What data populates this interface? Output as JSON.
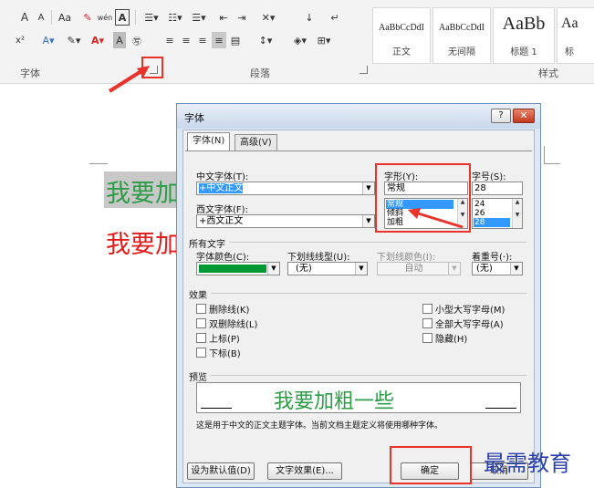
{
  "ribbon": {
    "font_buttons": [
      "A",
      "A",
      "Aa",
      "wén"
    ],
    "font_group_label": "字体",
    "paragraph_group_label": "段落",
    "styles_group_label": "样式",
    "styles": [
      {
        "sample": "AaBbCcDdI",
        "name": "正文"
      },
      {
        "sample": "AaBbCcDdI",
        "name": "无间隔"
      },
      {
        "sample": "AaBb",
        "name": "标题 1"
      },
      {
        "sample": "Aa",
        "name": "标"
      }
    ]
  },
  "document": {
    "line1": "我要加",
    "line2": "我要加",
    "line1_color": "#2e9b47",
    "line2_color": "#e31b1b",
    "highlight": "#c8c8c8"
  },
  "dialog": {
    "title": "字体",
    "tabs": [
      "字体(N)",
      "高级(V)"
    ],
    "chinese_font_label": "中文字体(T):",
    "chinese_font_value": "+中文正文",
    "western_font_label": "西文字体(F):",
    "western_font_value": "+西文正文",
    "style_label": "字形(Y):",
    "style_value": "常规",
    "style_options": [
      "常规",
      "倾斜",
      "加粗"
    ],
    "size_label": "字号(S):",
    "size_value": "28",
    "size_options": [
      "24",
      "26",
      "28"
    ],
    "all_text_label": "所有文字",
    "font_color_label": "字体颜色(C):",
    "font_color": "#009933",
    "underline_type_label": "下划线线型(U):",
    "underline_type_value": "(无)",
    "underline_color_label": "下划线颜色(I):",
    "underline_color_value": "自动",
    "emphasis_label": "着重号(·):",
    "emphasis_value": "(无)",
    "effects_label": "效果",
    "effects_left": [
      "删除线(K)",
      "双删除线(L)",
      "上标(P)",
      "下标(B)"
    ],
    "effects_right": [
      "小型大写字母(M)",
      "全部大写字母(A)",
      "隐藏(H)"
    ],
    "preview_label": "预览",
    "preview_text": "我要加粗一些",
    "preview_color": "#2e9b47",
    "note": "这是用于中文的正文主题字体。当前文档主题定义将使用哪种字体。",
    "set_default_label": "设为默认值(D)",
    "text_effects_label": "文字效果(E)...",
    "ok_label": "确定",
    "cancel_label": "取消",
    "help_label": "?",
    "close_label": "✕"
  },
  "watermark": "最需教育"
}
